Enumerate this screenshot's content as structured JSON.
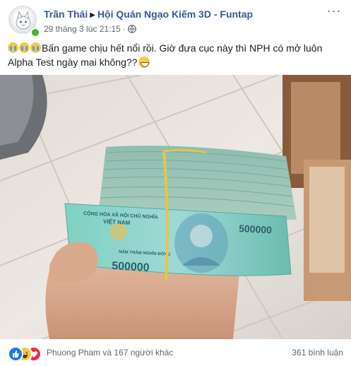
{
  "post": {
    "author": "Trần Thái",
    "group": "Hội Quán Ngạo Kiếm 3D - Funtap",
    "timestamp": "29 tháng 3 lúc 21:15",
    "meta_dot": "·",
    "text": "Bấn game chịu hết nổi rồi. Giờ đưa cục này thì NPH có mở luôn Alpha Test ngày mai không??",
    "leading_emojis": [
      "crying-face-icon",
      "crying-face-icon",
      "crying-face-icon"
    ],
    "trailing_emoji": "grinning-face-icon",
    "more_label": "···",
    "photo": {
      "banknote_top_text": "CỘNG HÒA XÃ HỘI CHỦ NGHĨA",
      "banknote_country": "VIỆT NAM",
      "banknote_words": "NĂM TRĂM NGHÌN ĐỒNG",
      "banknote_value_left": "500000",
      "banknote_value_right": "500000"
    }
  },
  "footer": {
    "reactors_text": "Phuong Pham và 167 người khác",
    "comments_text": "361 bình luận",
    "reactions": [
      "like-icon",
      "haha-icon",
      "love-icon"
    ]
  },
  "colors": {
    "link": "#385898",
    "meta": "#616770",
    "online": "#42b72a",
    "like": "#1877f2",
    "love": "#f0284a",
    "haha": "#f7c948",
    "banknote": "#6fc3b5"
  }
}
